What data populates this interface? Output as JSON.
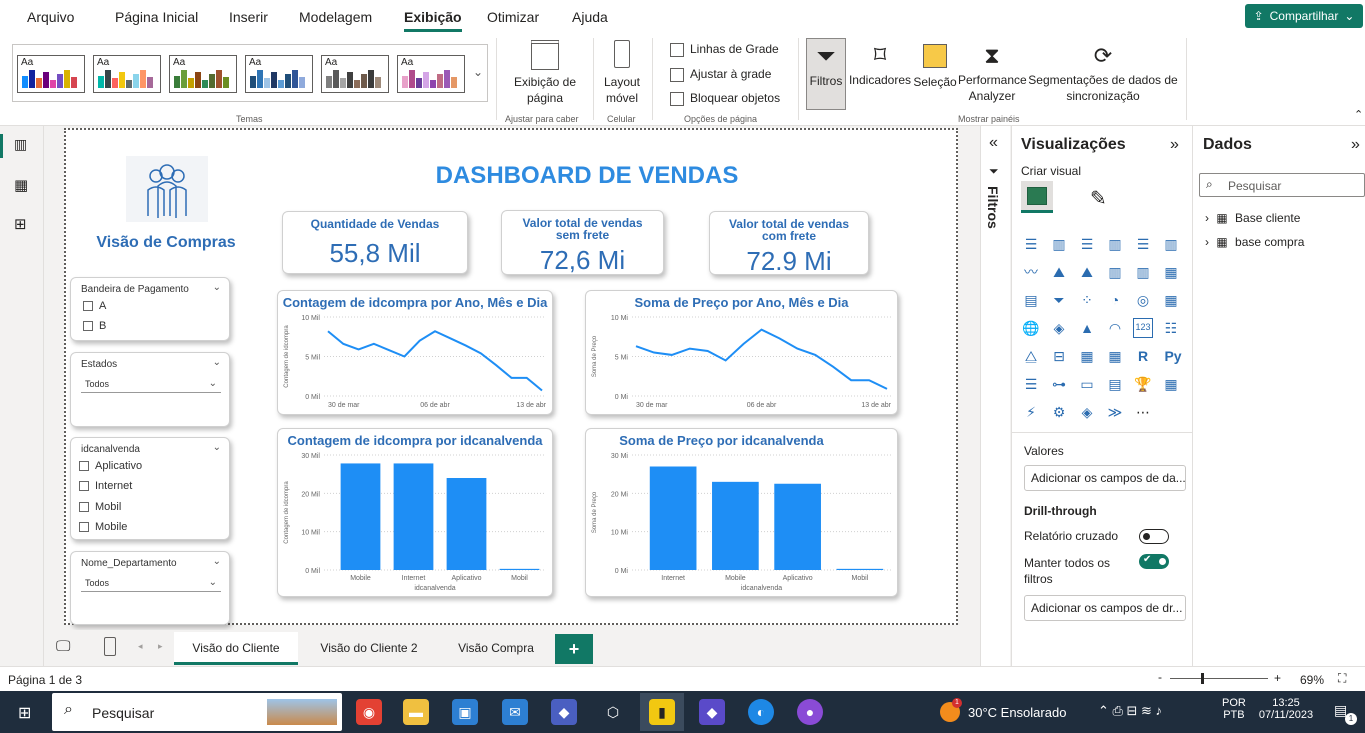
{
  "menu": {
    "items": [
      "Arquivo",
      "Página Inicial",
      "Inserir",
      "Modelagem",
      "Exibição",
      "Otimizar",
      "Ajuda"
    ],
    "active": "Exibição",
    "share_label": "Compartilhar"
  },
  "ribbon": {
    "theme_aa": "Aa",
    "themes_label": "Temas",
    "page_view_label": "Exibição de página",
    "adjust_label": "Ajustar para caber",
    "mobile_layout_label": "Layout móvel",
    "mobile_group_label": "Celular",
    "options": [
      "Linhas de Grade",
      "Ajustar à grade",
      "Bloquear objetos"
    ],
    "page_options_label": "Opções de página",
    "panes": [
      "Filtros",
      "Indicadores",
      "Seleção",
      "Performance Analyzer",
      "Segmentações de dados de sincronização"
    ],
    "show_panes_label": "Mostrar painéis"
  },
  "dashboard": {
    "title": "DASHBOARD DE VENDAS",
    "section_title": "Visão de Compras",
    "kpis": [
      {
        "title": "Quantidade de Vendas",
        "value": "55,8 Mil"
      },
      {
        "title": "Valor total de vendas sem frete",
        "value": "72,6 Mi"
      },
      {
        "title": "Valor total de vendas com frete",
        "value": "72.9 Mi"
      }
    ],
    "slicers": {
      "bandeira": {
        "title": "Bandeira de Pagamento",
        "items": [
          "A",
          "B"
        ]
      },
      "estados": {
        "title": "Estados",
        "value": "Todos"
      },
      "canal": {
        "title": "idcanalvenda",
        "items": [
          "Aplicativo",
          "Internet",
          "Mobil",
          "Mobile"
        ]
      },
      "departamento": {
        "title": "Nome_Departamento",
        "value": "Todos"
      }
    }
  },
  "chart_data": [
    {
      "type": "line",
      "title": "Contagem de idcompra por Ano, Mês e Dia",
      "ylabel": "Contagem de idcompra",
      "xlabel": "",
      "x_tick_labels": [
        "30 de mar",
        "06 de abr",
        "13 de abr"
      ],
      "y_tick_labels": [
        "0 Mil",
        "5 Mil",
        "10 Mil"
      ],
      "ylim": [
        0,
        10
      ],
      "x": [
        "30 de mar",
        "31 de mar",
        "01 de abr",
        "02 de abr",
        "03 de abr",
        "04 de abr",
        "05 de abr",
        "06 de abr",
        "07 de abr",
        "08 de abr",
        "09 de abr",
        "10 de abr",
        "11 de abr",
        "12 de abr",
        "13 de abr"
      ],
      "values": [
        8.2,
        6.6,
        5.9,
        6.6,
        5.8,
        5.0,
        7.0,
        8.2,
        7.3,
        6.4,
        5.4,
        3.9,
        2.3,
        2.3,
        0.7
      ],
      "color": "#1e8ef5"
    },
    {
      "type": "line",
      "title": "Soma de Preço por Ano, Mês e Dia",
      "ylabel": "Soma de Preço",
      "xlabel": "",
      "x_tick_labels": [
        "30 de mar",
        "06 de abr",
        "13 de abr"
      ],
      "y_tick_labels": [
        "0 Mi",
        "5 Mi",
        "10 Mi"
      ],
      "ylim": [
        0,
        10
      ],
      "x": [
        "30 de mar",
        "31 de mar",
        "01 de abr",
        "02 de abr",
        "03 de abr",
        "04 de abr",
        "05 de abr",
        "06 de abr",
        "07 de abr",
        "08 de abr",
        "09 de abr",
        "10 de abr",
        "11 de abr",
        "12 de abr",
        "13 de abr"
      ],
      "values": [
        6.3,
        5.5,
        5.2,
        6.0,
        5.7,
        4.5,
        6.6,
        8.4,
        7.3,
        6.0,
        5.2,
        3.7,
        2.0,
        2.0,
        0.9
      ],
      "color": "#1e8ef5"
    },
    {
      "type": "bar",
      "title": "Contagem de idcompra por idcanalvenda",
      "ylabel": "Contagem de idcompra",
      "xlabel": "idcanalvenda",
      "categories": [
        "Mobile",
        "Internet",
        "Aplicativo",
        "Mobil"
      ],
      "values": [
        27.8,
        27.8,
        24.0,
        0.3
      ],
      "y_tick_labels": [
        "0 Mil",
        "10 Mil",
        "20 Mil",
        "30 Mil"
      ],
      "ylim": [
        0,
        30
      ],
      "color": "#1e8ef5"
    },
    {
      "type": "bar",
      "title": "Soma de Preço por idcanalvenda",
      "ylabel": "Soma de Preço",
      "xlabel": "idcanalvenda",
      "categories": [
        "Internet",
        "Mobile",
        "Aplicativo",
        "Mobil"
      ],
      "values": [
        27.0,
        23.0,
        22.5,
        0.3
      ],
      "y_tick_labels": [
        "0 Mi",
        "10 Mi",
        "20 Mi",
        "30 Mi"
      ],
      "ylim": [
        0,
        30
      ],
      "color": "#1e8ef5"
    }
  ],
  "pages": {
    "tabs": [
      "Visão do Cliente",
      "Visão do Cliente 2",
      "Visão Compra"
    ],
    "active": "Visão do Cliente",
    "add_label": "+"
  },
  "status": {
    "page": "Página 1 de 3",
    "zoom": "69%"
  },
  "filters_pane": {
    "label": "Filtros"
  },
  "viz_pane": {
    "title": "Visualizações",
    "build_label": "Criar visual",
    "values_label": "Valores",
    "values_placeholder": "Adicionar os campos de da...",
    "drill_label": "Drill-through",
    "cross_report_label": "Relatório cruzado",
    "cross_report_on": false,
    "keep_filters_label": "Manter todos os filtros",
    "keep_filters_on": true,
    "drill_placeholder": "Adicionar os campos de dr..."
  },
  "data_pane": {
    "title": "Dados",
    "search_placeholder": "Pesquisar",
    "tables": [
      "Base cliente",
      "base compra"
    ]
  },
  "taskbar": {
    "search_label": "Pesquisar",
    "weather": "30°C  Ensolarado",
    "lang": "POR",
    "lang2": "PTB",
    "time": "13:25",
    "date": "07/11/2023",
    "notif_count": "1",
    "weather_badge": "1"
  },
  "colors": {
    "accent": "#117865",
    "chart_blue": "#1e8ef5",
    "title_blue": "#2e6db5"
  }
}
